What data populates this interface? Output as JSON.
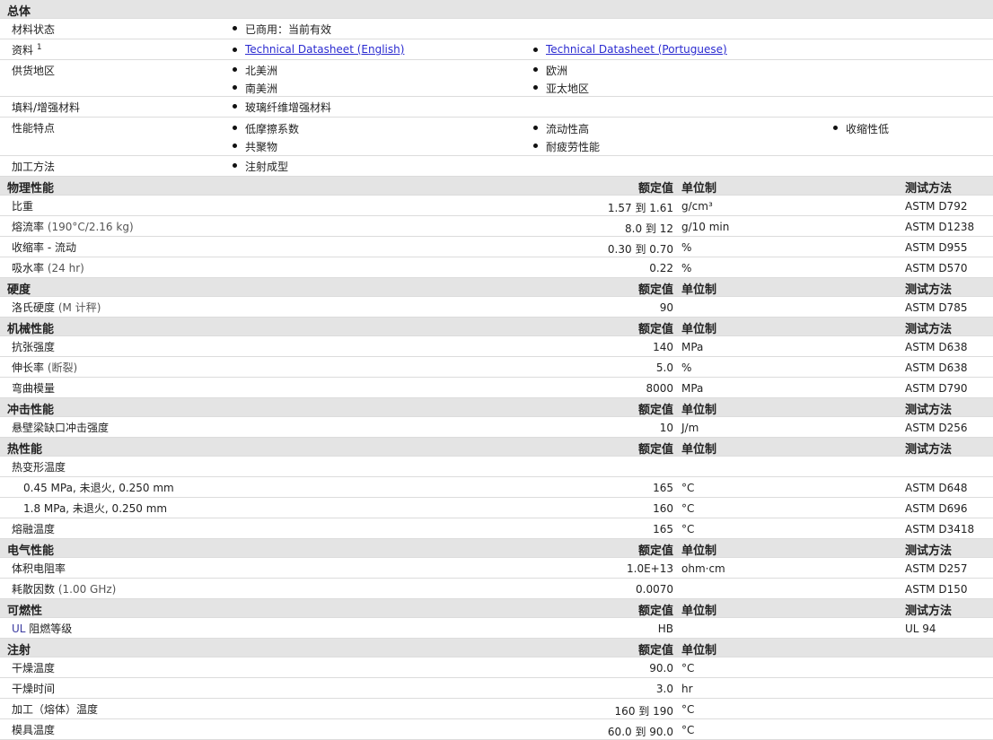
{
  "headers": {
    "value": "额定值",
    "unit": "单位制",
    "method": "测试方法"
  },
  "general": {
    "title": "总体",
    "status_label": "材料状态",
    "status_value": "已商用：当前有效",
    "docs_label": "资料",
    "docs_sup": "1",
    "doc1": "Technical Datasheet (English)",
    "doc2": "Technical Datasheet (Portuguese)",
    "region_label": "供货地区",
    "regions": [
      "北美洲",
      "欧洲",
      "南美洲",
      "亚太地区"
    ],
    "filler_label": "填料/增强材料",
    "filler_value": "玻璃纤维增强材料",
    "features_label": "性能特点",
    "features": [
      "低摩擦系数",
      "流动性高",
      "收缩性低",
      "共聚物",
      "耐疲劳性能"
    ],
    "process_label": "加工方法",
    "process_value": "注射成型"
  },
  "physical": {
    "title": "物理性能",
    "rows": [
      {
        "n": "比重",
        "v": "1.57 到 1.61",
        "u": "g/cm³",
        "m": "ASTM D792"
      },
      {
        "n": "熔流率",
        "p": "(190°C/2.16 kg)",
        "v": "8.0 到 12",
        "u": "g/10 min",
        "m": "ASTM D1238"
      },
      {
        "n": "收缩率 - 流动",
        "v": "0.30 到 0.70",
        "u": "%",
        "m": "ASTM D955"
      },
      {
        "n": "吸水率",
        "p": "(24 hr)",
        "v": "0.22",
        "u": "%",
        "m": "ASTM D570"
      }
    ]
  },
  "hardness": {
    "title": "硬度",
    "rows": [
      {
        "n": "洛氏硬度",
        "p": "(M 计秤)",
        "v": "90",
        "u": "",
        "m": "ASTM D785"
      }
    ]
  },
  "mechanical": {
    "title": "机械性能",
    "rows": [
      {
        "n": "抗张强度",
        "v": "140",
        "u": "MPa",
        "m": "ASTM D638"
      },
      {
        "n": "伸长率",
        "p": "(断裂)",
        "v": "5.0",
        "u": "%",
        "m": "ASTM D638"
      },
      {
        "n": "弯曲模量",
        "v": "8000",
        "u": "MPa",
        "m": "ASTM D790"
      }
    ]
  },
  "impact": {
    "title": "冲击性能",
    "rows": [
      {
        "n": "悬壁梁缺口冲击强度",
        "v": "10",
        "u": "J/m",
        "m": "ASTM D256"
      }
    ]
  },
  "thermal": {
    "title": "热性能",
    "hdt_label": "热变形温度",
    "rows": [
      {
        "n": "0.45 MPa, 未退火, 0.250 mm",
        "v": "165",
        "u": "°C",
        "m": "ASTM D648",
        "sub": true
      },
      {
        "n": "1.8 MPa, 未退火, 0.250 mm",
        "v": "160",
        "u": "°C",
        "m": "ASTM D696",
        "sub": true
      },
      {
        "n": "熔融温度",
        "v": "165",
        "u": "°C",
        "m": "ASTM D3418"
      }
    ]
  },
  "electrical": {
    "title": "电气性能",
    "rows": [
      {
        "n": "体积电阻率",
        "v": "1.0E+13",
        "u": "ohm·cm",
        "m": "ASTM D257"
      },
      {
        "n": "耗散因数",
        "p": "(1.00 GHz)",
        "v": "0.0070",
        "u": "",
        "m": "ASTM D150"
      }
    ]
  },
  "flammability": {
    "title": "可燃性",
    "rows": [
      {
        "n": "阻燃等级",
        "ul": "UL",
        "v": "HB",
        "u": "",
        "m": "UL 94"
      }
    ]
  },
  "injection": {
    "title": "注射",
    "rows": [
      {
        "n": "干燥温度",
        "v": "90.0",
        "u": "°C",
        "m": ""
      },
      {
        "n": "干燥时间",
        "v": "3.0",
        "u": "hr",
        "m": ""
      },
      {
        "n": "加工（熔体）温度",
        "v": "160 到 190",
        "u": "°C",
        "m": ""
      },
      {
        "n": "模具温度",
        "v": "60.0 到 90.0",
        "u": "°C",
        "m": ""
      }
    ]
  }
}
